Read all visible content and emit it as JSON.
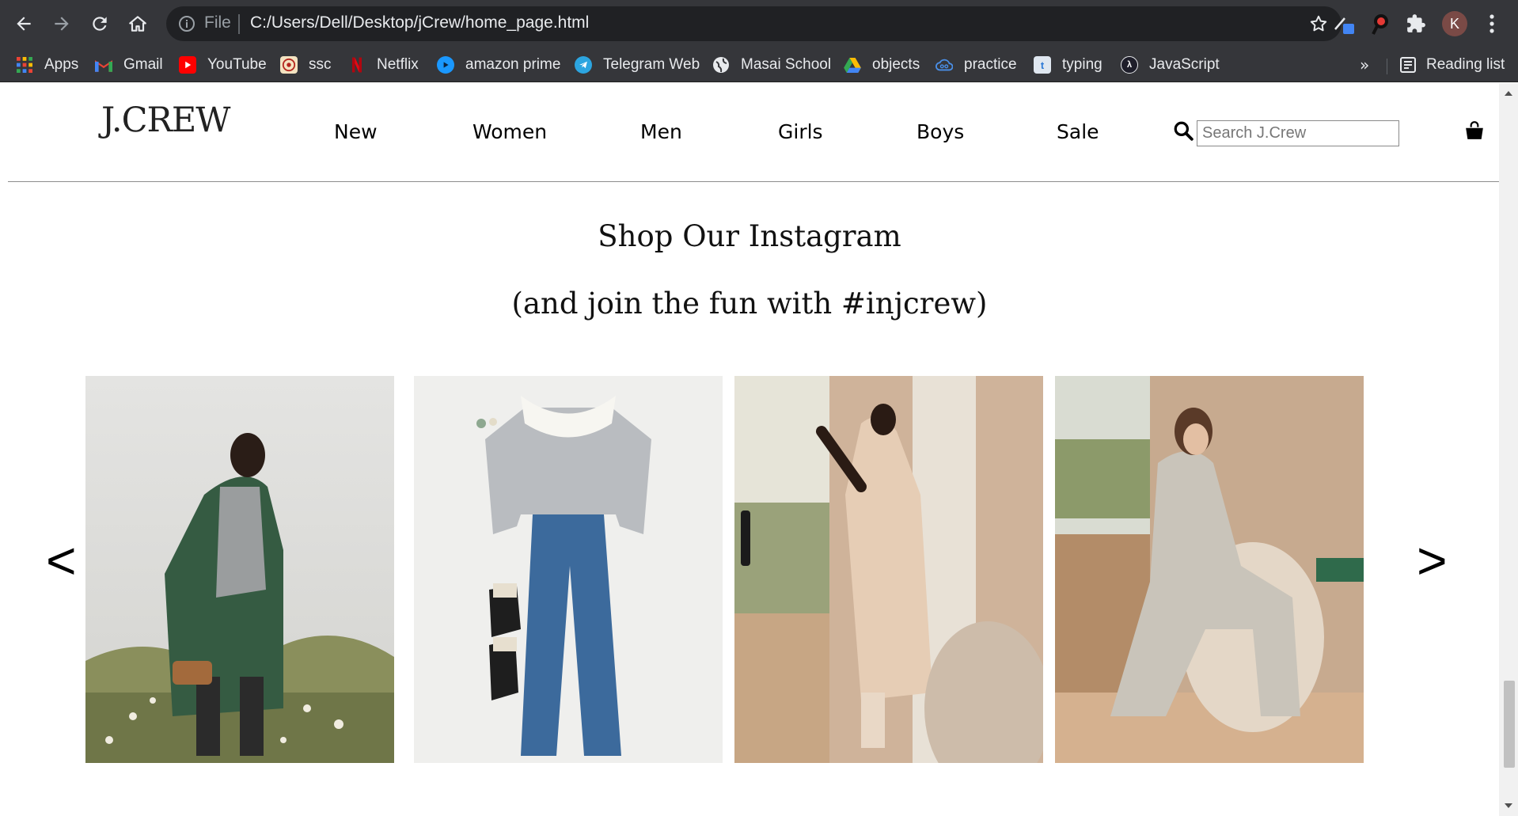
{
  "browser": {
    "file_label": "File",
    "url": "C:/Users/Dell/Desktop/jCrew/home_page.html",
    "profile_initial": "K",
    "bookmarks": [
      {
        "label": "Apps",
        "icon": "apps-grid-icon"
      },
      {
        "label": "Gmail",
        "icon": "gmail-icon"
      },
      {
        "label": "YouTube",
        "icon": "youtube-icon"
      },
      {
        "label": "ssc",
        "icon": "ssc-emblem-icon"
      },
      {
        "label": "Netflix",
        "icon": "netflix-icon"
      },
      {
        "label": "amazon prime",
        "icon": "prime-video-icon"
      },
      {
        "label": "Telegram Web",
        "icon": "telegram-icon"
      },
      {
        "label": "Masai School",
        "icon": "globe-icon"
      },
      {
        "label": "objects",
        "icon": "google-drive-icon"
      },
      {
        "label": "practice",
        "icon": "cloud-icon"
      },
      {
        "label": "typing",
        "icon": "typing-t-icon"
      },
      {
        "label": "JavaScript",
        "icon": "javascript-lambda-icon"
      }
    ],
    "more_label": "»",
    "reading_list_label": "Reading list"
  },
  "site": {
    "logo": "J.CREW",
    "nav": [
      "New",
      "Women",
      "Men",
      "Girls",
      "Boys",
      "Sale"
    ],
    "search_placeholder": "Search J.Crew"
  },
  "instagram": {
    "title": "Shop Our Instagram",
    "subtitle": "(and join the fun with #injcrew)",
    "prev": "<",
    "next": ">",
    "photos": [
      {
        "name": "photo-green-coat-field"
      },
      {
        "name": "photo-sweater-jeans-flatlay"
      },
      {
        "name": "photo-quilted-robe-window"
      },
      {
        "name": "photo-pajamas-chair"
      }
    ]
  }
}
